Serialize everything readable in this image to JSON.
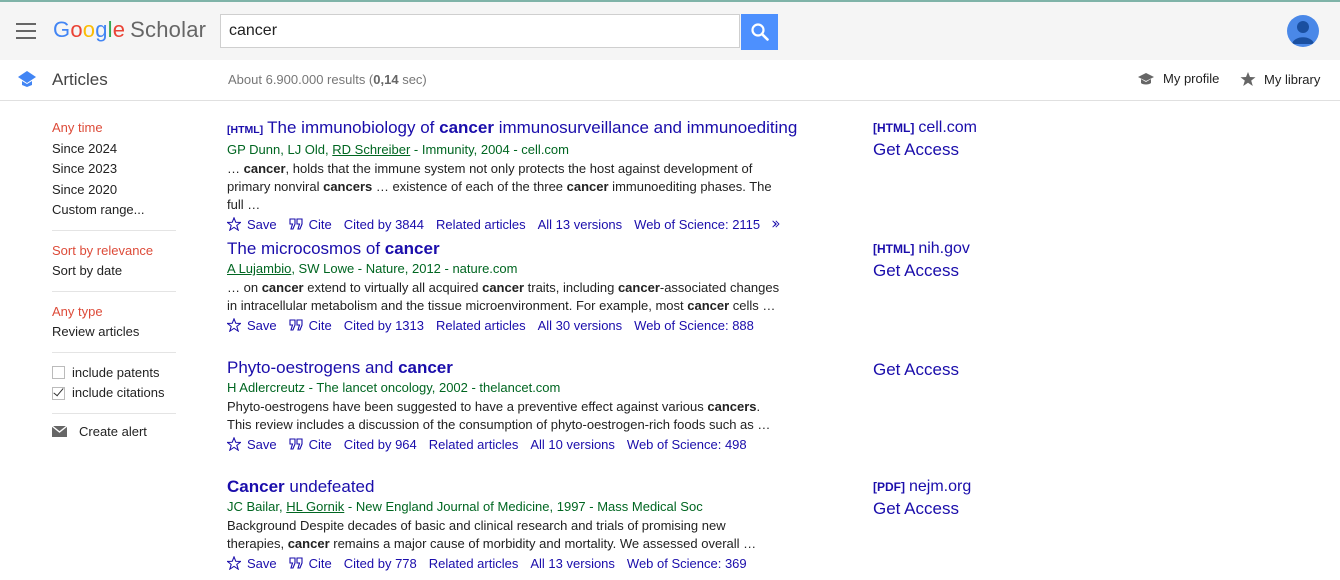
{
  "header": {
    "logo_google": [
      "G",
      "o",
      "o",
      "g",
      "l",
      "e"
    ],
    "logo_scholar": "Scholar",
    "search": {
      "value": "cancer",
      "placeholder": ""
    }
  },
  "subbar": {
    "section": "Articles",
    "results_prefix": "About 6.900.000 results (",
    "results_time": "0,14",
    "results_suffix": " sec)",
    "my_profile": "My profile",
    "my_library": "My library"
  },
  "sidebar": {
    "time": [
      "Any time",
      "Since 2024",
      "Since 2023",
      "Since 2020",
      "Custom range..."
    ],
    "sort": [
      "Sort by relevance",
      "Sort by date"
    ],
    "type": [
      "Any type",
      "Review articles"
    ],
    "include_patents": "include patents",
    "include_citations": "include citations",
    "create_alert": "Create alert"
  },
  "results": [
    {
      "tag": "[HTML]",
      "title_parts": [
        "The immunobiology of ",
        "cancer",
        " immunosurveillance and immunoediting"
      ],
      "authors_parts": [
        "GP Dunn, LJ Old, ",
        "RD Schreiber",
        " - Immunity, 2004 - cell.com"
      ],
      "snippet1_parts": [
        "… ",
        "cancer",
        ", holds that the immune system not only protects the host against development of"
      ],
      "snippet2_parts": [
        "primary nonviral ",
        "cancers",
        " … existence of each of the three ",
        "cancer",
        " immunoediting phases. The full …"
      ],
      "save": "Save",
      "cite": "Cite",
      "cited_by": "Cited by 3844",
      "related": "Related articles",
      "versions": "All 13 versions",
      "wos": "Web of Science: 2115",
      "side_tag": "[HTML]",
      "side_domain": "cell.com",
      "get_access": "Get Access"
    },
    {
      "title_parts": [
        "The microcosmos of ",
        "cancer"
      ],
      "authors_parts": [
        "A Lujambio",
        ", SW Lowe - Nature, 2012 - nature.com"
      ],
      "snippet1_parts": [
        "… on ",
        "cancer",
        " extend to virtually all acquired ",
        "cancer",
        " traits, including ",
        "cancer",
        "-associated changes"
      ],
      "snippet2_parts": [
        "in intracellular metabolism and the tissue microenvironment. For example, most ",
        "cancer",
        " cells …"
      ],
      "save": "Save",
      "cite": "Cite",
      "cited_by": "Cited by 1313",
      "related": "Related articles",
      "versions": "All 30 versions",
      "wos": "Web of Science: 888",
      "side_tag": "[HTML]",
      "side_domain": "nih.gov",
      "get_access": "Get Access"
    },
    {
      "title_parts": [
        "Phyto-oestrogens and ",
        "cancer"
      ],
      "authors_parts": [
        "H Adlercreutz - The lancet oncology, 2002 - thelancet.com"
      ],
      "snippet1_parts": [
        "Phyto-oestrogens have been suggested to have a preventive effect against various ",
        "cancers",
        "."
      ],
      "snippet2_parts": [
        "This review includes a discussion of the consumption of phyto-oestrogen-rich foods such as …"
      ],
      "save": "Save",
      "cite": "Cite",
      "cited_by": "Cited by 964",
      "related": "Related articles",
      "versions": "All 10 versions",
      "wos": "Web of Science: 498",
      "get_access": "Get Access"
    },
    {
      "title_parts": [
        "Cancer",
        " undefeated"
      ],
      "authors_parts": [
        "JC Bailar, ",
        "HL Gornik",
        " - New England Journal of Medicine, 1997 - Mass Medical Soc"
      ],
      "snippet1_parts": [
        "Background Despite decades of basic and clinical research and trials of promising new"
      ],
      "snippet2_parts": [
        "therapies, ",
        "cancer",
        " remains a major cause of morbidity and mortality. We assessed overall …"
      ],
      "save": "Save",
      "cite": "Cite",
      "cited_by": "Cited by 778",
      "related": "Related articles",
      "versions": "All 13 versions",
      "wos": "Web of Science: 369",
      "side_tag": "[PDF]",
      "side_domain": "nejm.org",
      "get_access": "Get Access"
    }
  ],
  "colors": {
    "link": "#1a0dab",
    "author_green": "#006621",
    "active_red": "#dd4b39",
    "search_blue": "#4d90fe"
  }
}
